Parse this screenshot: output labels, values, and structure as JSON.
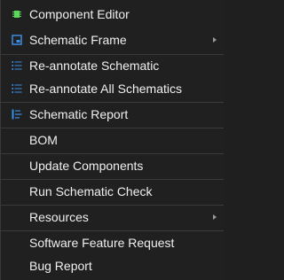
{
  "menu": {
    "items": [
      {
        "label": "Component Editor",
        "icon": "chip-icon"
      },
      {
        "label": "Schematic Frame",
        "icon": "frame-icon",
        "submenu": true
      },
      {
        "label": "Re-annotate Schematic",
        "icon": "numbered-list-icon"
      },
      {
        "label": "Re-annotate All Schematics",
        "icon": "numbered-list-icon"
      },
      {
        "label": "Schematic Report",
        "icon": "report-list-icon"
      },
      {
        "label": "BOM"
      },
      {
        "label": "Update Components"
      },
      {
        "label": "Run Schematic Check"
      },
      {
        "label": "Resources",
        "submenu": true
      },
      {
        "label": "Software Feature Request"
      },
      {
        "label": "Bug Report"
      }
    ]
  },
  "colors": {
    "background": "#202020",
    "text": "#f0f0f0",
    "icon_green": "#5cd85c",
    "icon_blue": "#3a8ee6",
    "separator": "#3b3b3b"
  }
}
